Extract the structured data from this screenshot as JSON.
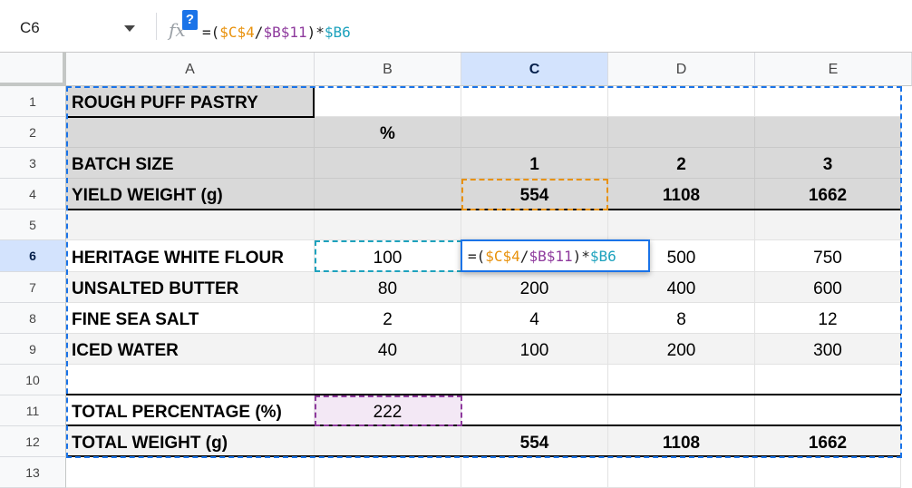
{
  "namebox": {
    "cell": "C6"
  },
  "formula_bar": {
    "fx_label": "fx",
    "help_label": "?",
    "formula_parts": [
      {
        "text": "=(",
        "color": "plain"
      },
      {
        "text": "$C$4",
        "color": "orange"
      },
      {
        "text": "/",
        "color": "plain"
      },
      {
        "text": "$B$11",
        "color": "purple"
      },
      {
        "text": ")*",
        "color": "plain"
      },
      {
        "text": "$B6",
        "color": "teal"
      }
    ]
  },
  "columns": [
    "A",
    "B",
    "C",
    "D",
    "E"
  ],
  "selected_column": "C",
  "rows": [
    "1",
    "2",
    "3",
    "4",
    "5",
    "6",
    "7",
    "8",
    "9",
    "10",
    "11",
    "12",
    "13"
  ],
  "selected_row": "6",
  "cells": {
    "A1": "ROUGH PUFF PASTRY",
    "B2": "%",
    "A3": "BATCH SIZE",
    "C3": "1",
    "D3": "2",
    "E3": "3",
    "A4": "YIELD WEIGHT (g)",
    "C4": "554",
    "D4": "1108",
    "E4": "1662",
    "A6": "HERITAGE WHITE FLOUR",
    "B6": "100",
    "D6": "500",
    "E6": "750",
    "A7": "UNSALTED BUTTER",
    "B7": "80",
    "C7": "200",
    "D7": "400",
    "E7": "600",
    "A8": "FINE SEA SALT",
    "B8": "2",
    "C8": "4",
    "D8": "8",
    "E8": "12",
    "A9": "ICED WATER",
    "B9": "40",
    "C9": "100",
    "D9": "200",
    "E9": "300",
    "A11": "TOTAL PERCENTAGE (%)",
    "B11": "222",
    "A12": "TOTAL WEIGHT (g)",
    "C12": "554",
    "D12": "1108",
    "E12": "1662"
  },
  "colors": {
    "orange": "#e8910b",
    "purple": "#8e3a9d",
    "teal": "#1ea2bd",
    "selection_blue": "#1a73e8"
  }
}
